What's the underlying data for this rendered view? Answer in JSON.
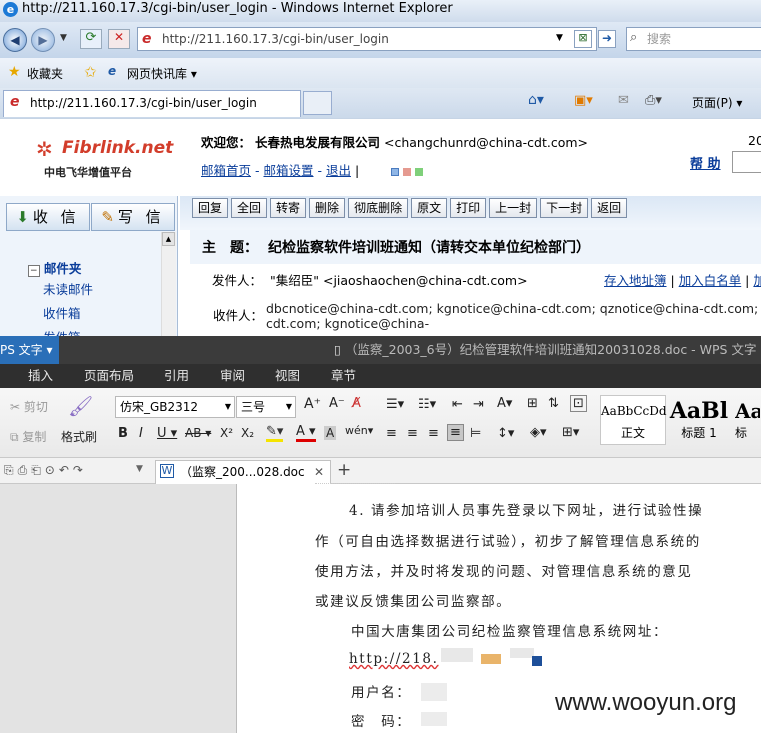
{
  "browser": {
    "title": "http://211.160.17.3/cgi-bin/user_login - Windows Internet Explorer",
    "address": "http://211.160.17.3/cgi-bin/user_login",
    "search_placeholder": "搜索",
    "favorites_label": "收藏夹",
    "web_slice_label": "网页快讯库",
    "tab_label": "http://211.160.17.3/cgi-bin/user_login",
    "page_menu": "页面(P)"
  },
  "mail": {
    "logo": "Fibrlink.net",
    "logo_sub": "中电飞华增值平台",
    "welcome_prefix": "欢迎您：",
    "company": "长春热电发展有限公司",
    "email": "<changchunrd@china-cdt.com>",
    "year_partial": "20",
    "links": [
      "邮箱首页",
      "邮箱设置",
      "退出"
    ],
    "help": "帮 助",
    "receive_btn": "收 信",
    "compose_btn": "写 信",
    "folders_title": "邮件夹",
    "folders": [
      "未读邮件",
      "收件箱",
      "发件箱"
    ],
    "toolbar": [
      "回复",
      "全回",
      "转寄",
      "删除",
      "彻底删除",
      "原文",
      "打印",
      "上一封",
      "下一封",
      "返回"
    ],
    "subject_label": "主　题：",
    "subject": "纪检监察软件培训班通知（请转交本单位纪检部门）",
    "from_label": "发件人：",
    "from_value": "\"集绍臣\" <jiaoshaochen@china-cdt.com>",
    "from_actions": [
      "存入地址簿",
      "加入白名单",
      "加"
    ],
    "to_label": "收件人：",
    "to_line1": "dbcnotice@china-cdt.com; kgnotice@china-cdt.com; qznotice@china-cdt.com; z",
    "to_line2": "cdt.com; kgnotice@china-"
  },
  "wps": {
    "title_app": "PS 文字",
    "title_doc": "（监察_2003_6号）纪检管理软件培训班通知20031028.doc - WPS 文字",
    "menu": [
      "插入",
      "页面布局",
      "引用",
      "审阅",
      "视图",
      "章节"
    ],
    "cut": "剪切",
    "copy": "复制",
    "format_painter": "格式刷",
    "font_name": "仿宋_GB2312",
    "font_size": "三号",
    "styles": [
      {
        "sample": "AaBbCcDd",
        "name": "正文"
      },
      {
        "sample": "AaBl",
        "name": "标题 1"
      },
      {
        "sample": "Aa",
        "name": "标"
      }
    ],
    "doc_tab": "（监察_200...028.doc"
  },
  "document": {
    "line1": "4. 请参加培训人员事先登录以下网址，进行试验性操",
    "line2": "作（可自由选择数据进行试验），初步了解管理信息系统的",
    "line3": "使用方法，并及时将发现的问题、对管理信息系统的意见",
    "line4": "或建议反馈集团公司监察部。",
    "line5": "中国大唐集团公司纪检监察管理信息系统网址：",
    "url_prefix": "http://218.",
    "user_label": "用户名：",
    "pwd_label": "密　码："
  },
  "watermark": "www.wooyun.org"
}
